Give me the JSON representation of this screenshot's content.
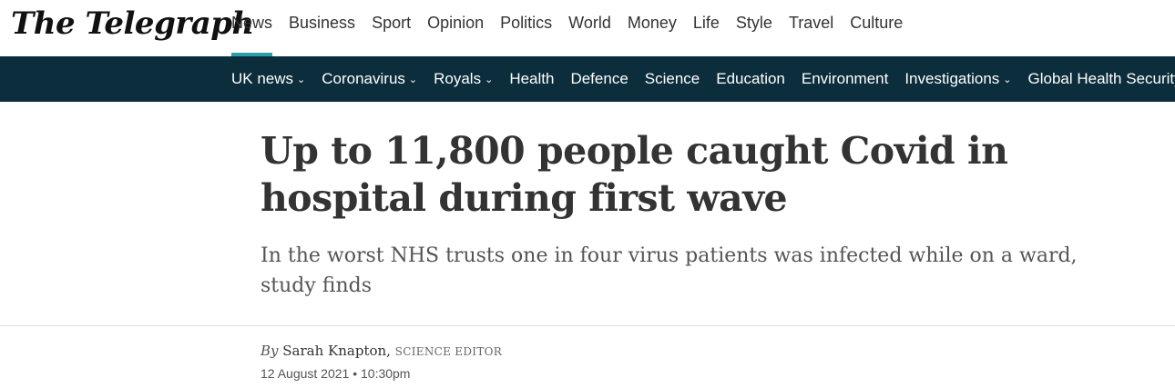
{
  "brand": {
    "logo_text": "The Telegraph"
  },
  "main_nav": [
    {
      "label": "News",
      "active": true
    },
    {
      "label": "Business"
    },
    {
      "label": "Sport"
    },
    {
      "label": "Opinion"
    },
    {
      "label": "Politics"
    },
    {
      "label": "World"
    },
    {
      "label": "Money"
    },
    {
      "label": "Life"
    },
    {
      "label": "Style"
    },
    {
      "label": "Travel"
    },
    {
      "label": "Culture"
    }
  ],
  "sub_nav": [
    {
      "label": "UK news",
      "dropdown": true
    },
    {
      "label": "Coronavirus",
      "dropdown": true
    },
    {
      "label": "Royals",
      "dropdown": true
    },
    {
      "label": "Health"
    },
    {
      "label": "Defence"
    },
    {
      "label": "Science"
    },
    {
      "label": "Education"
    },
    {
      "label": "Environment"
    },
    {
      "label": "Investigations",
      "dropdown": true
    },
    {
      "label": "Global Health Security",
      "dropdown": true
    }
  ],
  "article": {
    "headline": "Up to 11,800 people caught Covid in hospital during first wave",
    "standfirst": "In the worst NHS trusts one in four virus patients was infected while on a ward, study finds",
    "byline_prefix": "By",
    "author": "Sarah Knapton,",
    "author_role": "SCIENCE EDITOR",
    "date": "12 August 2021 • 10:30pm"
  },
  "colors": {
    "subnav_bg": "#0c2d3c",
    "active_underline": "#2a9fa8"
  },
  "icons": {
    "dropdown": "chevron-down-icon"
  }
}
